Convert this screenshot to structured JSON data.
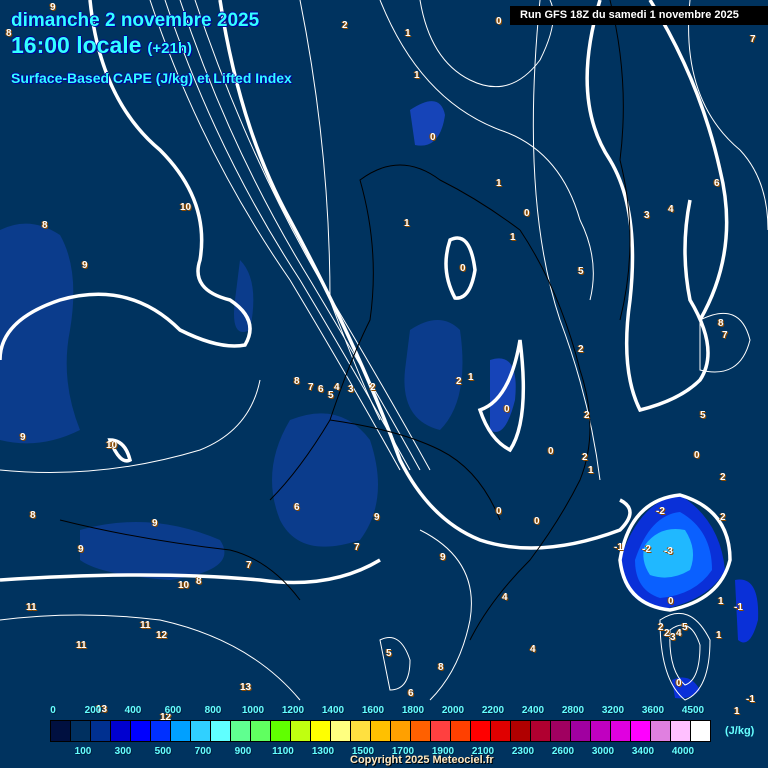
{
  "header": {
    "date": "dimanche 2 novembre 2025",
    "time": "16:00 locale",
    "lead": "(+21h)",
    "product": "Surface-Based CAPE (J/kg) et Lifted Index",
    "run": "Run GFS 18Z du samedi 1 novembre 2025"
  },
  "contour_labels": [
    "9",
    "8",
    "2",
    "1",
    "0",
    "7",
    "1",
    "0",
    "10",
    "8",
    "9",
    "1",
    "0",
    "1",
    "0",
    "1",
    "6",
    "3",
    "4",
    "5",
    "2",
    "8",
    "7",
    "9",
    "8",
    "7",
    "6",
    "5",
    "4",
    "3",
    "2",
    "2",
    "1",
    "0",
    "2",
    "5",
    "10",
    "0",
    "2",
    "9",
    "0",
    "2",
    "1",
    "6",
    "0",
    "8",
    "0",
    "2",
    "9",
    "7",
    "7",
    "9",
    "8",
    "9",
    "11",
    "10",
    "11",
    "12",
    "11",
    "13",
    "4",
    "5",
    "8",
    "6",
    "4",
    "-2",
    "-1",
    "-2",
    "-3",
    "2",
    "1",
    "0",
    "-1",
    "1",
    "2",
    "3",
    "4",
    "5",
    "1",
    "0",
    "-1",
    "12",
    "13"
  ],
  "legend": {
    "colors": [
      "#001040",
      "#003060",
      "#003090",
      "#0000d0",
      "#0000ff",
      "#0030ff",
      "#00a0ff",
      "#30d0ff",
      "#60ffff",
      "#60ff90",
      "#60ff60",
      "#60ff00",
      "#c0ff10",
      "#ffff00",
      "#ffff80",
      "#ffe040",
      "#ffc000",
      "#ffa000",
      "#ff6000",
      "#ff4040",
      "#ff4000",
      "#ff0000",
      "#e00000",
      "#b00000",
      "#b00030",
      "#a00060",
      "#a000a0",
      "#c000c0",
      "#e000e0",
      "#ff00ff",
      "#e080e0",
      "#ffc0ff",
      "#ffffff"
    ],
    "top_labels": [
      "0",
      "200",
      "400",
      "600",
      "800",
      "1000",
      "1200",
      "1400",
      "1600",
      "1800",
      "2000",
      "2200",
      "2400",
      "2800",
      "3200",
      "3600",
      "4500"
    ],
    "bottom_labels": [
      "100",
      "300",
      "500",
      "700",
      "900",
      "1100",
      "1300",
      "1500",
      "1700",
      "1900",
      "2100",
      "2300",
      "2600",
      "3000",
      "3400",
      "4000"
    ],
    "unit": "(J/kg)"
  },
  "copyright": "Copyright 2025 Meteociel.fr"
}
